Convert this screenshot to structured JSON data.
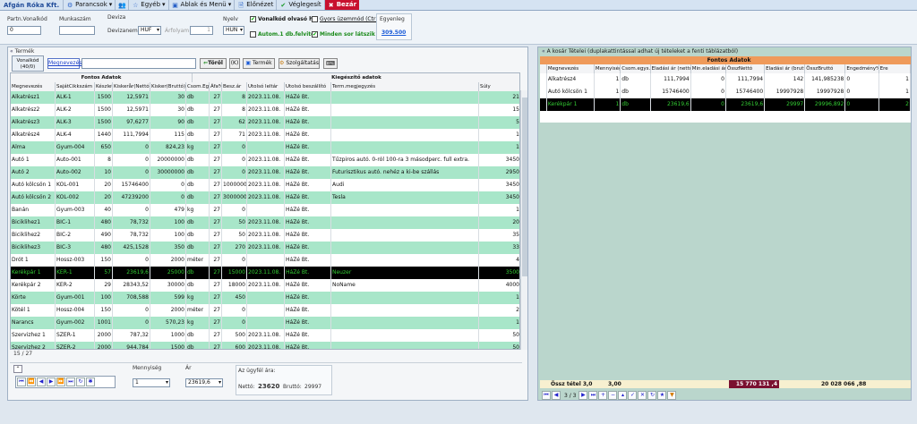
{
  "app": {
    "company": "Afgán Róka Kft.",
    "toolbar": {
      "parancsok": "Parancsok",
      "egyeb": "Egyéb",
      "ablak": "Ablak és Menü",
      "elonezet": "Előnézet",
      "veglegesit": "Véglegesít",
      "bezar": "Bezár"
    }
  },
  "header": {
    "partn_label": "Partn.Vonalkód",
    "partn_value": "0",
    "munkaszam_label": "Munkaszám",
    "munkaszam_value": "",
    "deviza_label": "Deviza",
    "devizanem_label": "Devizanem",
    "devizanem_value": "HUF",
    "arfolyam_label": "Árfolyam",
    "arfolyam_value": "1",
    "nyelv_label": "Nyelv",
    "nyelv_value": "HUN",
    "vonalkod_olvaso": "Vonalkód olvasó h",
    "gyors_uzemmod": "Gyors üzemmód (Ctrl",
    "autom": "Autom.1 db.felvitel",
    "minden_sor": "Minden sor látszik",
    "egyenleg_label": "Egyenleg",
    "egyenleg_value": "309.500"
  },
  "left": {
    "section_label": "Termék",
    "vonalkod_btn": "Vonalkód\n(40/0)",
    "megnevezes_btn": "Megnevezés",
    "torol_btn": "Töröl",
    "k_btn": "(K)",
    "termek_btn": "Termék",
    "szolg_btn": "Szolgáltatás",
    "group1": "Fontos Adatok",
    "group2": "Kiegészítő adatok",
    "columns": [
      "Megnevezés",
      "SajátCikkszám",
      "Készlet",
      "Kiskerår(Nettó)",
      "Kisker(Bruttó)",
      "Csom.Egys.",
      "Áfa%",
      "Besz.ár",
      "Utolsó leltár",
      "Utolsó beszállító",
      "Term.megjegyzés",
      "Súly"
    ],
    "rows": [
      [
        "Alkatrész1",
        "ALK-1",
        "1500",
        "12,5971",
        "30",
        "db",
        "27",
        "8",
        "2023.11.08.",
        "HáZé Bt.",
        "",
        "21"
      ],
      [
        "Alkatrész2",
        "ALK-2",
        "1500",
        "12,5971",
        "30",
        "db",
        "27",
        "8",
        "2023.11.08.",
        "HáZé Bt.",
        "",
        "15"
      ],
      [
        "Alkatrész3",
        "ALK-3",
        "1500",
        "97,6277",
        "90",
        "db",
        "27",
        "62",
        "2023.11.08.",
        "HáZé Bt.",
        "",
        "5"
      ],
      [
        "Alkatrész4",
        "ALK-4",
        "1440",
        "111,7994",
        "115",
        "db",
        "27",
        "71",
        "2023.11.08.",
        "HáZé Bt.",
        "",
        "1"
      ],
      [
        "Alma",
        "Gyum-004",
        "650",
        "0",
        "824,23",
        "kg",
        "27",
        "0",
        "",
        "HáZé Bt.",
        "",
        "1"
      ],
      [
        "Autó 1",
        "Auto-001",
        "8",
        "0",
        "20000000",
        "db",
        "27",
        "0",
        "2023.11.08.",
        "HáZé Bt.",
        "Tűzpiros autó. 0-ról 100-ra 3 másodperc. full extra.",
        "3450"
      ],
      [
        "Autó 2",
        "Auto-002",
        "10",
        "0",
        "30000000",
        "db",
        "27",
        "0",
        "2023.11.08.",
        "HáZé Bt.",
        "Futurisztikus autó. nehéz a ki-be szállás",
        "2950"
      ],
      [
        "Autó kölcsön 1",
        "KOL-001",
        "20",
        "15746400",
        "0",
        "db",
        "27",
        "10000000",
        "2023.11.08.",
        "HáZé Bt.",
        "Audi",
        "3450"
      ],
      [
        "Autó kölcsön 2",
        "KOL-002",
        "20",
        "47239200",
        "0",
        "db",
        "27",
        "30000000",
        "2023.11.08.",
        "HáZé Bt.",
        "Tesla",
        "3450"
      ],
      [
        "Banán",
        "Gyum-003",
        "40",
        "0",
        "479",
        "kg",
        "27",
        "0",
        "",
        "HáZé Bt.",
        "",
        "1"
      ],
      [
        "Biciklihez1",
        "BIC-1",
        "480",
        "78,732",
        "100",
        "db",
        "27",
        "50",
        "2023.11.08.",
        "HáZé Bt.",
        "",
        "20"
      ],
      [
        "Biciklihez2",
        "BIC-2",
        "490",
        "78,732",
        "100",
        "db",
        "27",
        "50",
        "2023.11.08.",
        "HáZé Bt.",
        "",
        "35"
      ],
      [
        "Biciklihez3",
        "BIC-3",
        "480",
        "425,1528",
        "350",
        "db",
        "27",
        "270",
        "2023.11.08.",
        "HáZé Bt.",
        "",
        "33"
      ],
      [
        "Drót 1",
        "Hossz-003",
        "150",
        "0",
        "2000",
        "méter",
        "27",
        "0",
        "",
        "HáZé Bt.",
        "",
        "4"
      ],
      [
        "Kerékpár 1",
        "KER-1",
        "57",
        "23619,6",
        "25000",
        "db",
        "27",
        "15000",
        "2023.11.08.",
        "HáZé Bt.",
        "Neuzer",
        "3500"
      ],
      [
        "Kerékpár 2",
        "KER-2",
        "29",
        "28343,52",
        "30000",
        "db",
        "27",
        "18000",
        "2023.11.08.",
        "HáZé Bt.",
        "NoName",
        "4000"
      ],
      [
        "Körte",
        "Gyum-001",
        "100",
        "708,588",
        "599",
        "kg",
        "27",
        "450",
        "",
        "HáZé Bt.",
        "",
        "1"
      ],
      [
        "Kötél 1",
        "Hossz-004",
        "150",
        "0",
        "2000",
        "méter",
        "27",
        "0",
        "",
        "HáZé Bt.",
        "",
        "2"
      ],
      [
        "Narancs",
        "Gyum-002",
        "1001",
        "0",
        "570,23",
        "kg",
        "27",
        "0",
        "",
        "HáZé Bt.",
        "",
        "1"
      ],
      [
        "Szervizhez 1",
        "SZER-1",
        "2000",
        "787,32",
        "1000",
        "db",
        "27",
        "500",
        "2023.11.08.",
        "HáZé Bt.",
        "",
        "50"
      ],
      [
        "Szervizhez 2",
        "SZER-2",
        "2000",
        "944,784",
        "1500",
        "db",
        "27",
        "600",
        "2023.11.08.",
        "HáZé Bt.",
        "",
        "50"
      ]
    ],
    "selected_index": 14,
    "record_count": "15 / 27",
    "mennyiseg_label": "Mennyiség",
    "mennyiseg_value": "1",
    "ar_label": "Ár",
    "ar_value": "23619,6",
    "ugyfel_label": "Az ügyfél ára:",
    "netto_label": "Nettó:",
    "netto_value": "23620",
    "brutto_label": "Bruttó:",
    "brutto_value": "29997"
  },
  "right": {
    "caption": "A kosár Tételei (duplakattintással adhat új tételeket a fenti táblázatból)",
    "group": "Fontos Adatok",
    "columns": [
      "Megnevezés",
      "Mennyiség",
      "Csom.egys.",
      "Eladási ár (nettó)",
      "Min.eladási ár",
      "ÖsszNettó",
      "Eladási ár (bruttó)",
      "ÖsszBruttó",
      "Engedmény%",
      "Ere"
    ],
    "rows": [
      [
        "Alkatrész4",
        "1",
        "db",
        "111,7994",
        "0",
        "111,7994",
        "142",
        "141,985238",
        "0",
        "1"
      ],
      [
        "Autó kölcsön 1",
        "1",
        "db",
        "15746400",
        "0",
        "15746400",
        "19997928",
        "19997928",
        "0",
        "1"
      ],
      [
        "Kerékpár 1",
        "1",
        "db",
        "23619,6",
        "0",
        "23619,6",
        "29997",
        "29996,892",
        "0",
        "2"
      ]
    ],
    "selected_index": 2,
    "ossz_tetel": "Össz tétel 3,0",
    "ossz_menny": "3,00",
    "ossz_netto": "15 770 131 ,4",
    "ossz_brutto": "20 028 066 ,88",
    "record_count": "3 / 3"
  },
  "colors": {
    "teal_row": "#a8e6c9",
    "white_row": "#ffffff",
    "orange_header": "#f0a060",
    "selected": "#000000",
    "dark_red": "#7a1030"
  }
}
